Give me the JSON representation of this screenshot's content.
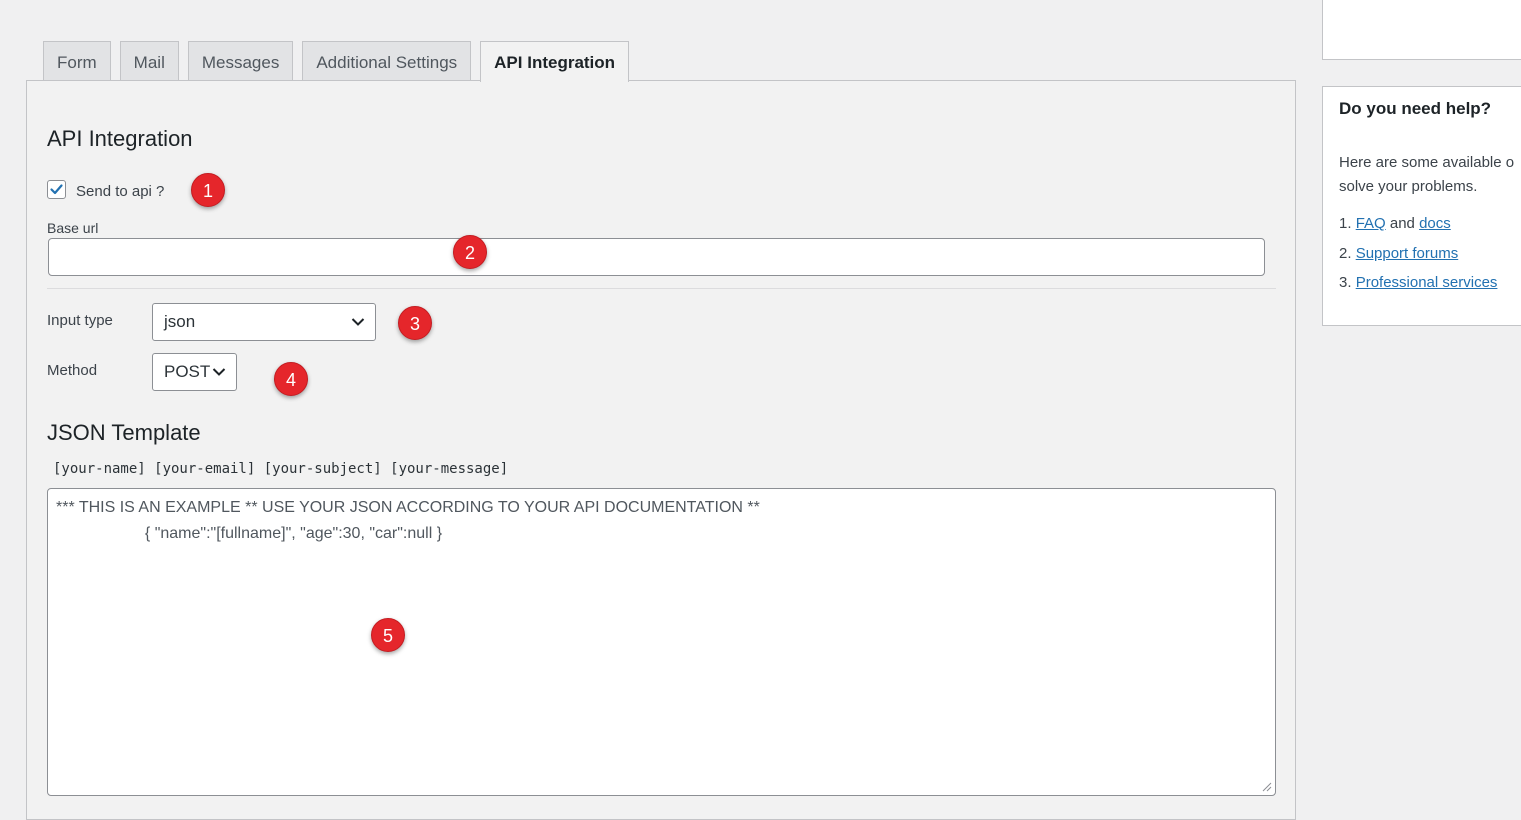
{
  "tabs": [
    {
      "label": "Form"
    },
    {
      "label": "Mail"
    },
    {
      "label": "Messages"
    },
    {
      "label": "Additional Settings"
    },
    {
      "label": "API Integration",
      "active": true
    }
  ],
  "section": {
    "title": "API Integration",
    "send_to_api": {
      "label": "Send to api ?",
      "checked": true
    },
    "base_url": {
      "label": "Base url",
      "value": ""
    },
    "input_type": {
      "label": "Input type",
      "selected": "json"
    },
    "method": {
      "label": "Method",
      "selected": "POST"
    },
    "json_template": {
      "title": "JSON Template",
      "tags": "[your-name] [your-email] [your-subject] [your-message]",
      "line1": "*** THIS IS AN EXAMPLE ** USE YOUR JSON ACCORDING TO YOUR API DOCUMENTATION **",
      "line2": "                    { \"name\":\"[fullname]\", \"age\":30, \"car\":null }"
    }
  },
  "markers": [
    "1",
    "2",
    "3",
    "4",
    "5"
  ],
  "sidebar": {
    "help_title": "Do you need help?",
    "help_text_line1": "Here are some available o",
    "help_text_line2": "solve your problems.",
    "items": [
      {
        "num": "1.",
        "link1": "FAQ",
        "and": "and",
        "link2": "docs"
      },
      {
        "num": "2.",
        "link1": "Support forums"
      },
      {
        "num": "3.",
        "link1": "Professional services"
      }
    ]
  },
  "colors": {
    "accent": "#2271b1",
    "marker": "#e5262b"
  }
}
